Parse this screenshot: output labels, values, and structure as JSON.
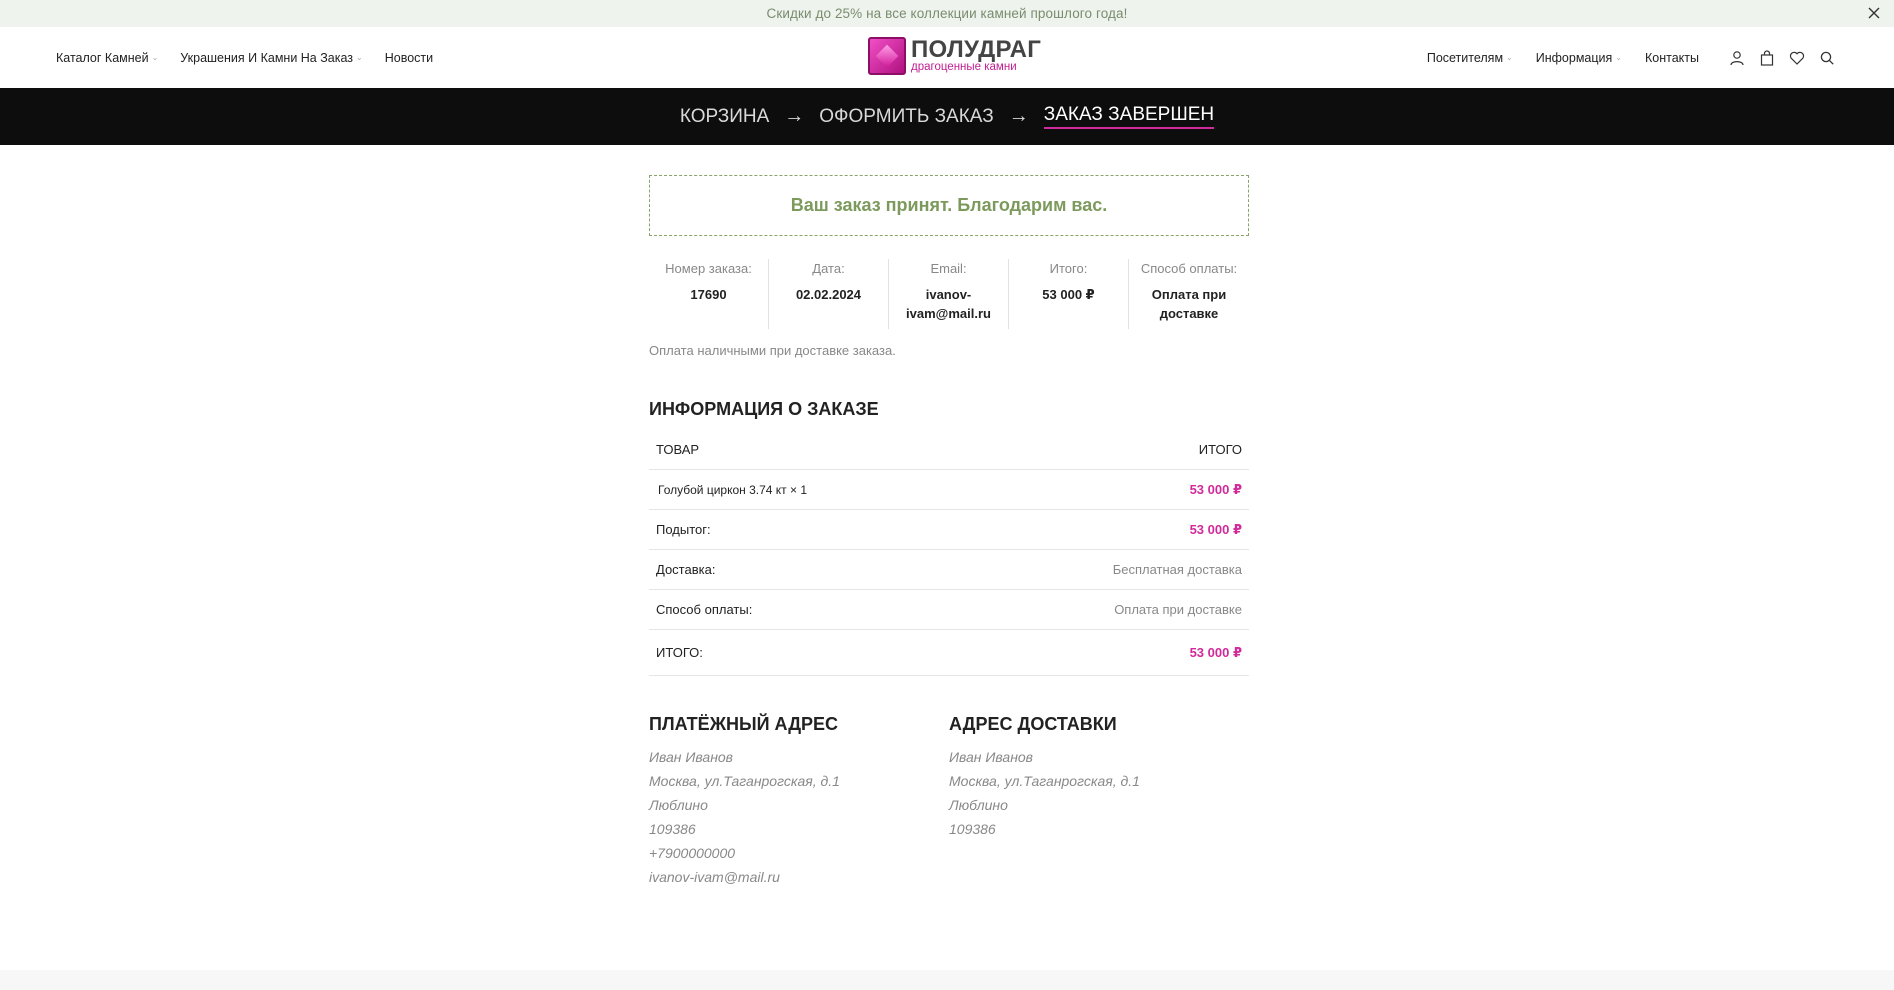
{
  "promo": {
    "text": "Скидки до 25% на все коллекции камней прошлого года!",
    "close_icon": "close-icon"
  },
  "header": {
    "nav_left": [
      {
        "label": "Каталог Камней",
        "has_dropdown": true
      },
      {
        "label": "Украшения И Камни На Заказ",
        "has_dropdown": true
      },
      {
        "label": "Новости",
        "has_dropdown": false
      }
    ],
    "logo": {
      "title": "ПОЛУДРАГ",
      "subtitle": "драгоценные камни"
    },
    "nav_right": [
      {
        "label": "Посетителям",
        "has_dropdown": true
      },
      {
        "label": "Информация",
        "has_dropdown": true
      },
      {
        "label": "Контакты",
        "has_dropdown": false
      }
    ],
    "icons": [
      "user-icon",
      "bag-icon",
      "heart-icon",
      "search-icon"
    ]
  },
  "steps": {
    "items": [
      "КОРЗИНА",
      "ОФОРМИТЬ ЗАКАЗ",
      "ЗАКАЗ ЗАВЕРШЕН"
    ],
    "arrow": "→",
    "active_index": 2
  },
  "order": {
    "thanks": "Ваш заказ принят. Благодарим вас.",
    "overview": [
      {
        "label": "Номер заказа:",
        "value": "17690"
      },
      {
        "label": "Дата:",
        "value": "02.02.2024"
      },
      {
        "label": "Email:",
        "value": "ivanov-ivam@mail.ru"
      },
      {
        "label": "Итого:",
        "value": "53 000 ₽"
      },
      {
        "label": "Способ оплаты:",
        "value": "Оплата при доставке"
      }
    ],
    "payment_note": "Оплата наличными при доставке заказа.",
    "details_title": "ИНФОРМАЦИЯ О ЗАКАЗЕ",
    "table": {
      "col_product": "ТОВАР",
      "col_total": "ИТОГО",
      "items": [
        {
          "name": "Голубой циркон 3.74 кт × 1",
          "price": "53 000 ₽"
        }
      ],
      "subtotal_label": "Подытог:",
      "subtotal_value": "53 000 ₽",
      "shipping_label": "Доставка:",
      "shipping_value": "Бесплатная доставка",
      "payment_label": "Способ оплаты:",
      "payment_value": "Оплата при доставке",
      "total_label": "ИТОГО:",
      "total_value": "53 000 ₽"
    }
  },
  "billing": {
    "title": "ПЛАТЁЖНЫЙ АДРЕС",
    "lines": [
      "Иван Иванов",
      "Москва, ул.Таганрогская, д.1",
      "Люблино",
      "109386",
      "+7900000000",
      "ivanov-ivam@mail.ru"
    ]
  },
  "shipping": {
    "title": "АДРЕС ДОСТАВКИ",
    "lines": [
      "Иван Иванов",
      "Москва, ул.Таганрогская, д.1",
      "Люблино",
      "109386"
    ]
  },
  "colors": {
    "accent": "#d12a9a",
    "success": "#7d9a5d",
    "steps_bg": "#0d0d0d",
    "promo_bg": "#eef3ee"
  }
}
